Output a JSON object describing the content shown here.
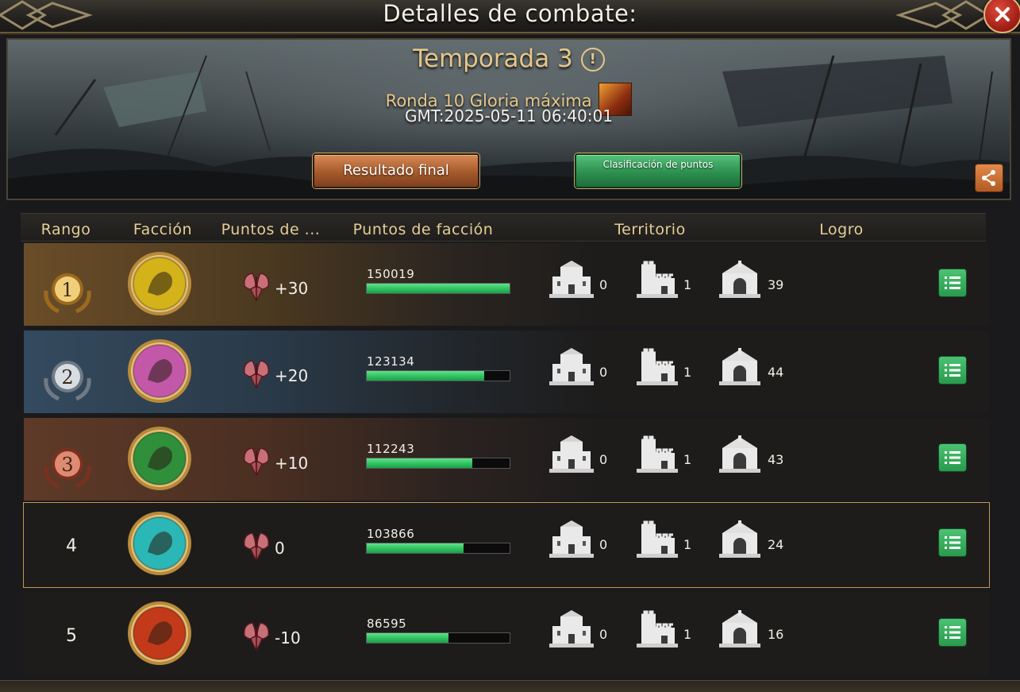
{
  "window": {
    "title": "Detalles de combate:"
  },
  "banner": {
    "season": "Temporada 3",
    "round": "Ronda 10 Gloria máxima",
    "datetime": "GMT:2025-05-11 06:40:01",
    "final_button": "Resultado final",
    "ranking_button": "Clasificación de puntos"
  },
  "table": {
    "headers": {
      "rank": "Rango",
      "faction": "Facción",
      "glory_points": "Puntos de ...",
      "faction_points": "Puntos de facción",
      "territory": "Territorio",
      "achievement": "Logro"
    },
    "rows": [
      {
        "rank": "1",
        "crest": "stark-direwolf-crest",
        "crest_color": "#d4b21a",
        "glory": "+30",
        "points": "150019",
        "progress": 1.0,
        "terr_a": "0",
        "terr_b": "1",
        "terr_c": "39"
      },
      {
        "rank": "2",
        "crest": "baratheon-stag-crest",
        "crest_color": "#c458a8",
        "glory": "+20",
        "points": "123134",
        "progress": 0.82,
        "terr_a": "0",
        "terr_b": "1",
        "terr_c": "44"
      },
      {
        "rank": "3",
        "crest": "tyrell-rose-crest",
        "crest_color": "#2f8f3a",
        "glory": "+10",
        "points": "112243",
        "progress": 0.74,
        "terr_a": "0",
        "terr_b": "1",
        "terr_c": "43"
      },
      {
        "rank": "4",
        "crest": "greyjoy-kraken-crest",
        "crest_color": "#2ab7b5",
        "glory": "0",
        "points": "103866",
        "progress": 0.68,
        "terr_a": "0",
        "terr_b": "1",
        "terr_c": "24"
      },
      {
        "rank": "5",
        "crest": "lannister-lion-crest",
        "crest_color": "#c23a1a",
        "glory": "-10",
        "points": "86595",
        "progress": 0.57,
        "terr_a": "0",
        "terr_b": "1",
        "terr_c": "16"
      }
    ]
  },
  "colors": {
    "accent_gold": "#e7cd97",
    "progress_green": "#2bbf5e",
    "final_button": "#a55a2c",
    "ranking_button": "#2d9050",
    "highlight_border": "#c49550"
  }
}
